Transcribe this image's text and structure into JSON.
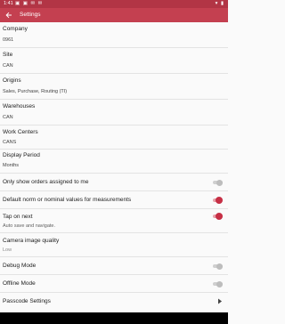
{
  "status_bar": {
    "time": "1:41",
    "left_icons": "▣ ▣ ✉ ✉",
    "right_icons": "▾ ▮"
  },
  "app_bar": {
    "title": "Settings"
  },
  "settings": {
    "company": {
      "label": "Company",
      "value": "0961"
    },
    "site": {
      "label": "Site",
      "value": "CAN"
    },
    "origins": {
      "label": "Origins",
      "value": "Sales, Purchase, Routing (TI)"
    },
    "warehouses": {
      "label": "Warehouses",
      "value": "CAN"
    },
    "work_centers": {
      "label": "Work Centers",
      "value": "CANS"
    },
    "display_period": {
      "label": "Display Period",
      "value": "Months"
    },
    "only_my_orders": {
      "label": "Only show orders assigned to me",
      "enabled": false
    },
    "default_norm": {
      "label": "Default norm or nominal values for measurements",
      "enabled": true
    },
    "tap_on_next": {
      "label": "Tap on next",
      "sub": "Auto save and navigate.",
      "enabled": true
    },
    "camera_quality": {
      "label": "Camera image quality",
      "value": "Low"
    },
    "debug_mode": {
      "label": "Debug Mode",
      "enabled": false
    },
    "offline_mode": {
      "label": "Offline Mode",
      "enabled": false
    },
    "passcode": {
      "label": "Passcode Settings"
    }
  },
  "colors": {
    "status_bar": "#b23545",
    "app_bar": "#c44050",
    "accent": "#c62f45"
  }
}
